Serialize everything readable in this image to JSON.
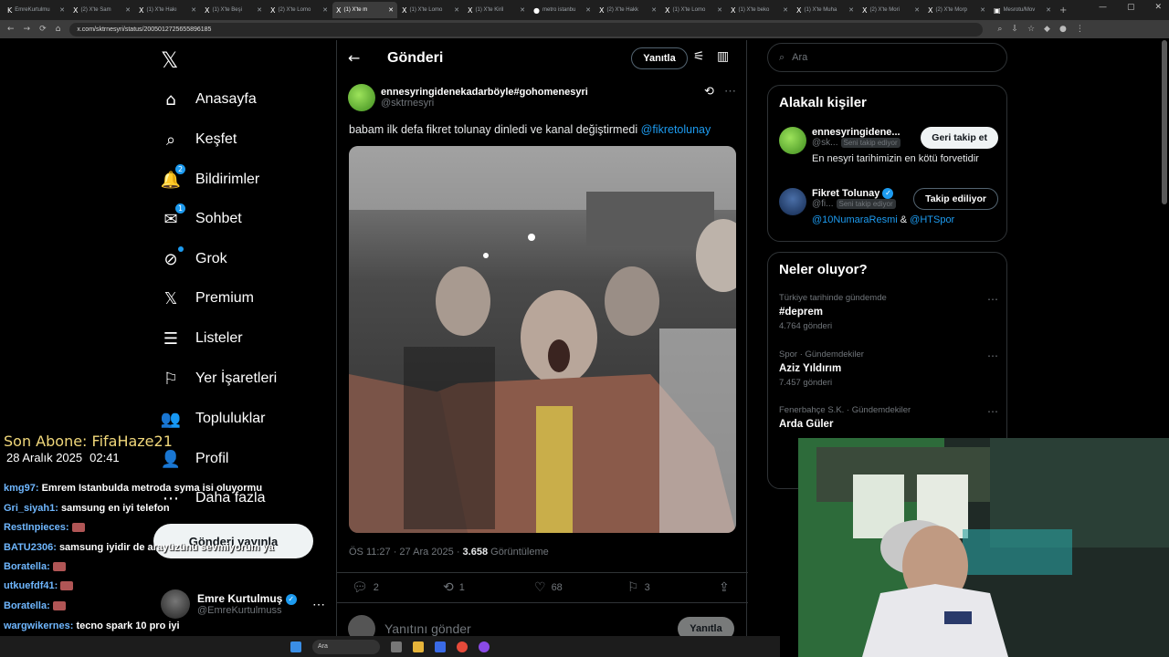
{
  "browser": {
    "tabs": [
      {
        "label": "EmreKurtulmu",
        "icon": "K",
        "active": false
      },
      {
        "label": "(2) X'te Sam",
        "icon": "X",
        "active": false
      },
      {
        "label": "(1) X'te Hakı",
        "icon": "X",
        "active": false
      },
      {
        "label": "(1) X'te Beşi",
        "icon": "X",
        "active": false
      },
      {
        "label": "(2) X'te Lomo",
        "icon": "X",
        "active": false
      },
      {
        "label": "(1) X'te m",
        "icon": "X",
        "active": true
      },
      {
        "label": "(1) X'te Lomo",
        "icon": "X",
        "active": false
      },
      {
        "label": "(1) X'te Kiril",
        "icon": "X",
        "active": false
      },
      {
        "label": "metro istanbu",
        "icon": "●",
        "active": false
      },
      {
        "label": "(2) X'te Hakk",
        "icon": "X",
        "active": false
      },
      {
        "label": "(1) X'te Lomo",
        "icon": "X",
        "active": false
      },
      {
        "label": "(1) X'te beko",
        "icon": "X",
        "active": false
      },
      {
        "label": "(1) X'te Muha",
        "icon": "X",
        "active": false
      },
      {
        "label": "(2) X'te Mori",
        "icon": "X",
        "active": false
      },
      {
        "label": "(2) X'te Morp",
        "icon": "X",
        "active": false
      },
      {
        "label": "Mesrotu/Mov",
        "icon": "▣",
        "active": false
      }
    ],
    "url": "x.com/sktrnesyri/status/2005012725655896185"
  },
  "nav": {
    "logo": "𝕏",
    "items": [
      {
        "label": "Anasayfa",
        "icon": "⌂",
        "name": "home"
      },
      {
        "label": "Keşfet",
        "icon": "⌕",
        "name": "explore"
      },
      {
        "label": "Bildirimler",
        "icon": "🔔",
        "name": "notifications",
        "badge": "2"
      },
      {
        "label": "Sohbet",
        "icon": "✉",
        "name": "chat",
        "badge": "1"
      },
      {
        "label": "Grok",
        "icon": "⊘",
        "name": "grok",
        "dot": true
      },
      {
        "label": "Premium",
        "icon": "𝕏",
        "name": "premium"
      },
      {
        "label": "Listeler",
        "icon": "☰",
        "name": "lists"
      },
      {
        "label": "Yer İşaretleri",
        "icon": "⚐",
        "name": "bookmarks"
      },
      {
        "label": "Topluluklar",
        "icon": "👥",
        "name": "communities"
      },
      {
        "label": "Profil",
        "icon": "👤",
        "name": "profile"
      },
      {
        "label": "Daha fazla",
        "icon": "⋯",
        "name": "more"
      }
    ],
    "post_button": "Gönderi yayınla",
    "account": {
      "name": "Emre Kurtulmuş",
      "handle": "@EmreKurtulmuss",
      "more": "⋯"
    }
  },
  "header": {
    "title": "Gönderi",
    "back": "←",
    "reply_button": "Yanıtla",
    "filter_icon": "⚟",
    "layout_icon": "▥"
  },
  "tweet": {
    "author_name": "ennesyringidenekadarböyle#gohomenesyri",
    "author_handle": "@sktrnesyri",
    "text": "babam ilk defa fikret tolunay dinledi ve kanal değiştirmedi",
    "mention": "@fikretolunay",
    "time": "ÖS 11:27 · 27 Ara 2025 · ",
    "views": "3.658",
    "views_label": " Görüntüleme",
    "replies": "2",
    "retweets": "1",
    "likes": "68",
    "bookmarks": "3",
    "reply_placeholder": "Yanıtını gönder",
    "reply_send": "Yanıtla"
  },
  "sidebar": {
    "search_placeholder": "Ara",
    "related_title": "Alakalı kişiler",
    "people": [
      {
        "name": "ennesyringidene...",
        "handle": "@sk...",
        "follows_you": "Seni takip ediyor",
        "bio": "En nesyri tarihimizin en kötü forvetidir",
        "button": "Geri takip et",
        "color": "#5cb82f"
      },
      {
        "name": "Fikret Tolunay",
        "handle": "@fi...",
        "follows_you": "Seni takip ediyor",
        "bio_mention1": "@10NumaraResmi",
        "bio_amp": " & ",
        "bio_mention2": "@HTSpor",
        "button": "Takip ediliyor",
        "color": "#2a4f8c"
      }
    ],
    "trends_title": "Neler oluyor?",
    "trends": [
      {
        "context": "Türkiye tarihinde gündemde",
        "title": "#deprem",
        "count": "4.764 gönderi"
      },
      {
        "context": "Spor · Gündemdekiler",
        "title": "Aziz Yıldırım",
        "count": "7.457 gönderi"
      },
      {
        "context": "Fenerbahçe S.K. · Gündemdekiler",
        "title": "Arda Güler",
        "count": ""
      }
    ]
  },
  "stream": {
    "last_sub": "Son Abone: FifaHaze21",
    "date": "28 Aralık 2025",
    "time": "02:41",
    "chat": [
      {
        "user": "kmg97:",
        "msg": "Emrem Istanbulda metroda syma isi oluyormu"
      },
      {
        "user": "Gri_siyah1:",
        "msg": "samsung en iyi telefon"
      },
      {
        "user": "RestInpieces:",
        "msg": ""
      },
      {
        "user": "BATU2306:",
        "msg": "samsung iyidir de arayüzünü sevmiyorum ya"
      },
      {
        "user": "Boratella:",
        "msg": ""
      },
      {
        "user": "utkuefdf41:",
        "msg": ""
      },
      {
        "user": "Boratella:",
        "msg": ""
      },
      {
        "user": "wargwikernes:",
        "msg": "tecno spark 10 pro iyi"
      },
      {
        "user": "utkuefdf41:",
        "msg": ""
      }
    ]
  },
  "taskbar": {
    "search": "Ara"
  }
}
